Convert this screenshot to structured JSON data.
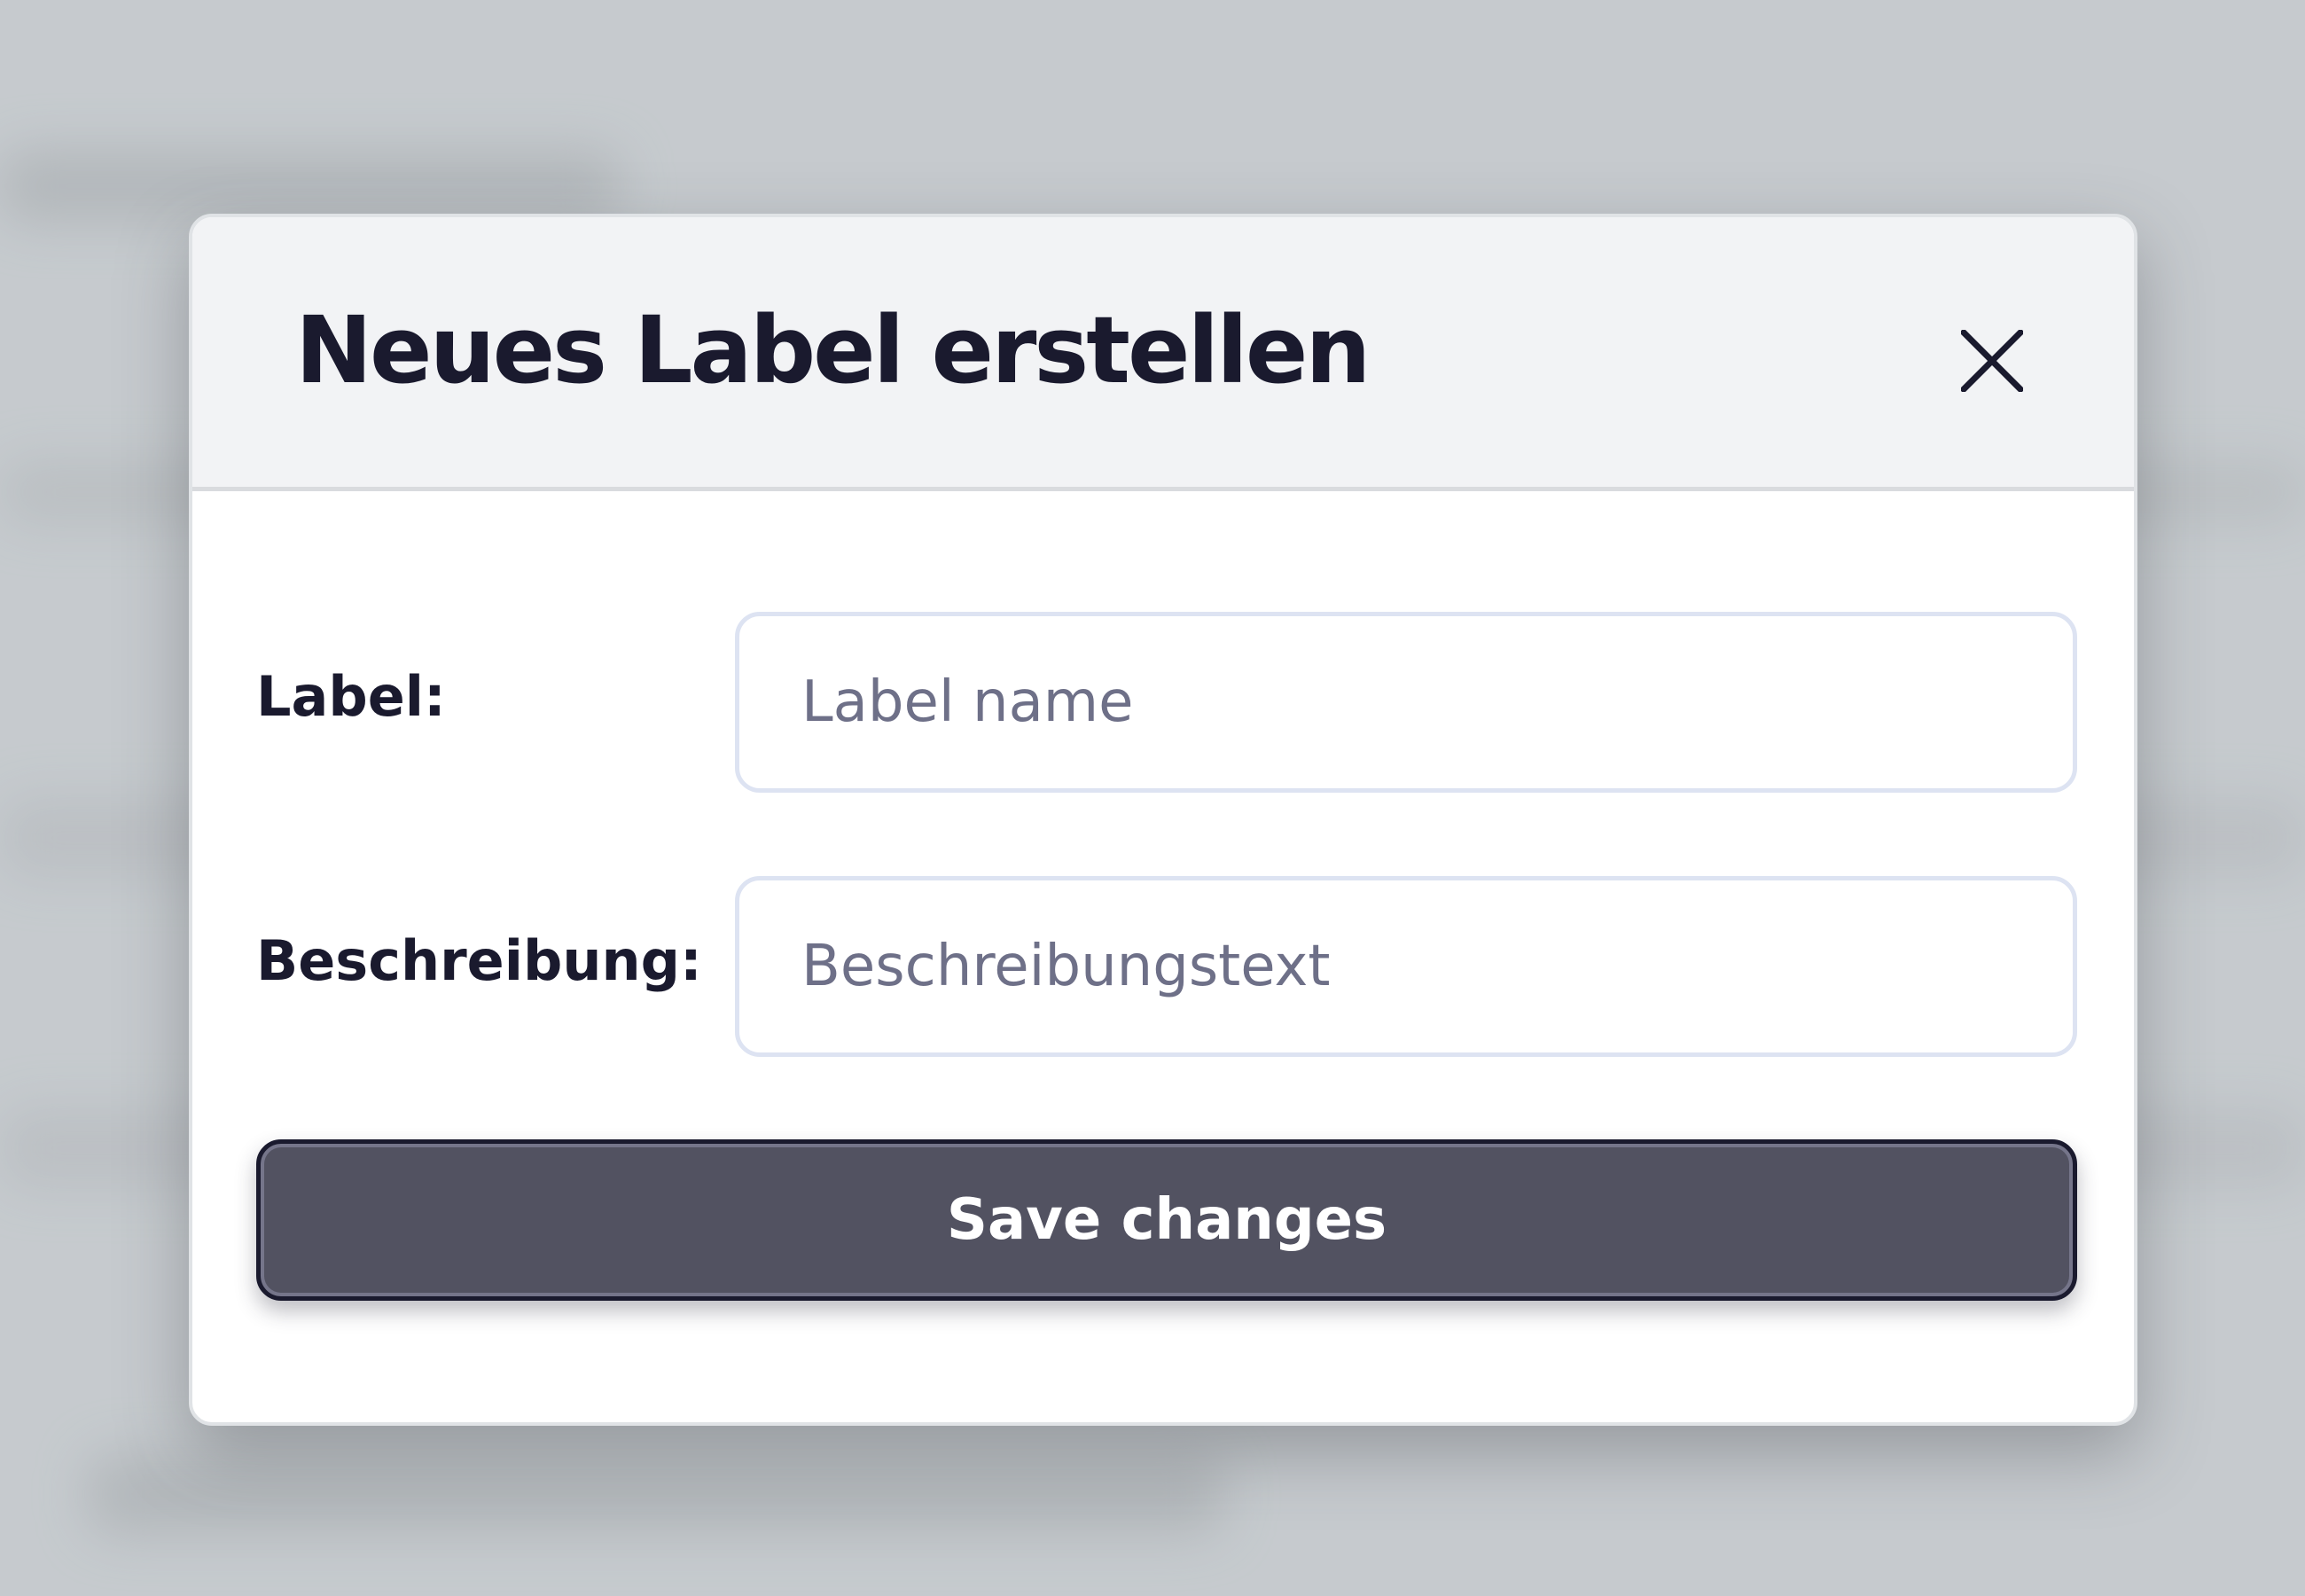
{
  "modal": {
    "title": "Neues Label erstellen",
    "close_icon": "close-icon",
    "fields": [
      {
        "label": "Label:",
        "placeholder": "Label name",
        "value": ""
      },
      {
        "label": "Beschreibung:",
        "placeholder": "Beschreibungstext",
        "value": ""
      }
    ],
    "save_label": "Save changes"
  },
  "colors": {
    "title_text": "#1a1a2e",
    "header_bg": "#f2f3f5",
    "button_bg": "#525261",
    "button_border": "#1a1a2e",
    "input_border": "#dde3f2",
    "placeholder_text": "#6e7088",
    "backdrop": "#c6cace"
  }
}
